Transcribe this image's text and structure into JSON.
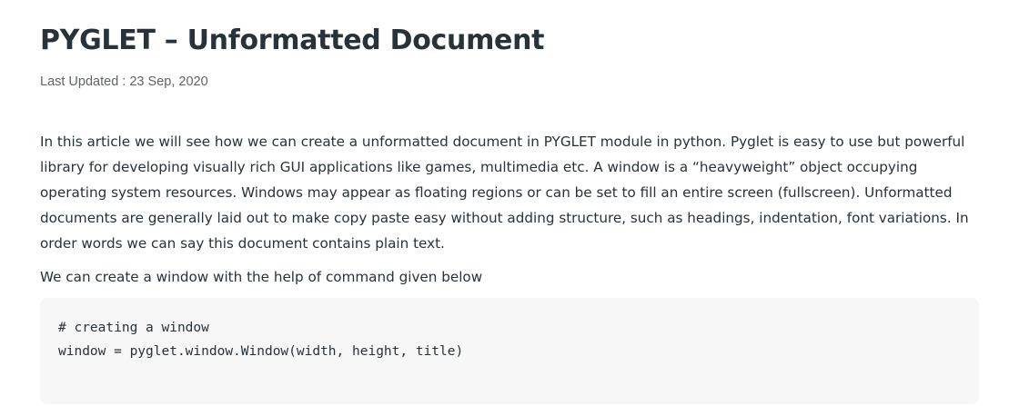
{
  "article": {
    "title": "PYGLET – Unformatted Document",
    "meta": {
      "label": "Last Updated",
      "separator": " : ",
      "date": "23 Sep, 2020"
    },
    "paragraphs": [
      "In this article we will see how we can create a unformatted document in PYGLET module in python. Pyglet is easy to use but powerful library for developing visually rich GUI applications like games, multimedia etc. A window is a “heavyweight” object occupying operating system resources. Windows may appear as floating regions or can be set to fill an entire screen (fullscreen). Unformatted documents are generally laid out to make copy paste easy without adding structure, such as headings, indentation, font variations. In order words we can say this document contains plain text.",
      "We can create a window with the help of command given below"
    ],
    "code": {
      "lines": [
        "# creating a window",
        "window = pyglet.window.Window(width, height, title)"
      ]
    }
  },
  "colors": {
    "text": "#273239",
    "meta": "#5f6368",
    "code_bg": "#f7f7f7"
  }
}
